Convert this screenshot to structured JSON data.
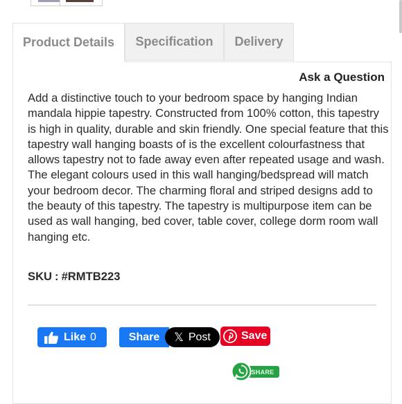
{
  "tabs": [
    {
      "label": "Product Details",
      "active": true
    },
    {
      "label": "Specification",
      "active": false
    },
    {
      "label": "Delivery",
      "active": false
    }
  ],
  "ask_question": "Ask a Question",
  "description": "Add a distinctive touch to your bedroom space by hanging Indian mandala hippie tapestry. Constructed from 100% cotton, this tapestry is high in quality, durable and skin friendly. One special feature that this tapestry wall hanging boasts of is the excellent colourfastness that allows tapestry not to fade away even after repeated usage and wash. The elegant colours used in this wall hanging/bedspread  will match your bedroom decor. The charming floral and striped designs add to the beauty of this tapestry. The tapestry is multipurpose item can be used as wall hanging, bed cover, table cover, college dorm room wall hanging etc.",
  "sku": {
    "label": "SKU",
    "separator": ":",
    "value": "#RMTB223"
  },
  "social": {
    "like_label": "Like",
    "like_count": "0",
    "share_label": "Share",
    "post_label": "Post",
    "save_label": "Save",
    "whatsapp_label": "SHARE"
  },
  "colors": {
    "facebook": "#1877f2",
    "x": "#000000",
    "pinterest": "#e60023",
    "whatsapp": "#25a244"
  },
  "icons": [
    "facebook-thumb-icon",
    "x-logo-icon",
    "pinterest-icon",
    "whatsapp-icon"
  ]
}
